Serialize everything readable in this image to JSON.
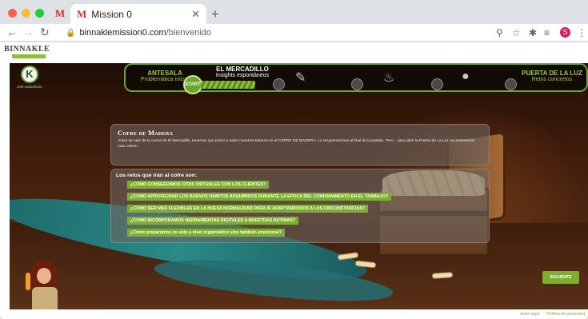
{
  "browser": {
    "pinned_tab_icon": "gmail-icon",
    "tab_title": "Mission 0",
    "tab_icon": "gmail-icon",
    "url_domain": "binnaklemission0.com",
    "url_path": "/bienvenido",
    "profile_initial": "S"
  },
  "site": {
    "logo_text": "BINNAKLE"
  },
  "game": {
    "jefe_label": "Jefe Expedición",
    "badge_letter": "K",
    "progress": {
      "left_title": "ANTESALA",
      "left_sub": "Problemática inicial",
      "center_title": "EL MERCADILLO",
      "center_sub": "Insights espontáneos",
      "right_title": "PUERTA DE LA LUZ",
      "right_sub": "Retos concretos",
      "start_label": "START"
    },
    "intro": {
      "title": "Cofre de Madera",
      "body": "Antes de salir de la cueva de El Mercadillo, tenemos que poner a salvo nuestros tesoros en el COFRE DE MADERA. Lo recuperaremos al final de la partida. Pero... para abrir la Puerta de La Luz necesitaremos más cofres!"
    },
    "retos": {
      "heading": "Los retos que irán al cofre son:",
      "items": [
        "¿COMO CONSEGUIMOS CITAS VIRTUALES CON LOS CLIENTES?",
        "¿COMO APROVECHAR LOS BUENOS HABITOS ADQUIRIDOS DURANTE LA EPOCA DEL CONFINAMIENTO EN EL TRABAJO?",
        "¿COMO SER MAS FLEXIBLES EN LA NUEVA NORMALIDAD PARA IR ADAPTANDONOS A LAS CIRCUNSTANCIAS?",
        "¿COMO INCORPORAMOS HERRAMIENTAS DIGITALES A NUESTRAS RUTINAS?",
        "¿Cómo preparamos no solo a nivel organizativo sino también emocional?"
      ]
    },
    "next_button": "SIGUIENTE"
  },
  "footer": {
    "aviso_legal": "Aviso legal",
    "privacidad": "Política de privacidad"
  }
}
